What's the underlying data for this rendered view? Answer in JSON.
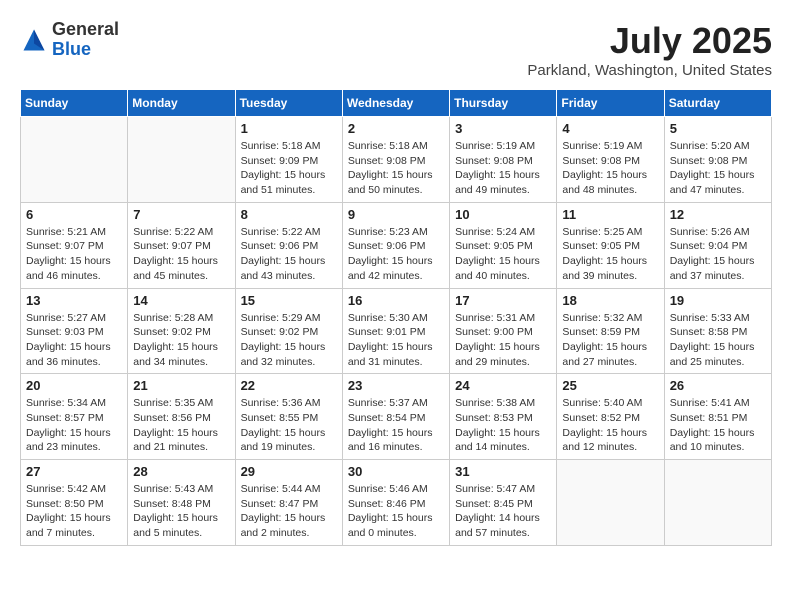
{
  "header": {
    "logo_general": "General",
    "logo_blue": "Blue",
    "month_title": "July 2025",
    "location": "Parkland, Washington, United States"
  },
  "weekdays": [
    "Sunday",
    "Monday",
    "Tuesday",
    "Wednesday",
    "Thursday",
    "Friday",
    "Saturday"
  ],
  "weeks": [
    [
      {
        "day": "",
        "info": ""
      },
      {
        "day": "",
        "info": ""
      },
      {
        "day": "1",
        "info": "Sunrise: 5:18 AM\nSunset: 9:09 PM\nDaylight: 15 hours\nand 51 minutes."
      },
      {
        "day": "2",
        "info": "Sunrise: 5:18 AM\nSunset: 9:08 PM\nDaylight: 15 hours\nand 50 minutes."
      },
      {
        "day": "3",
        "info": "Sunrise: 5:19 AM\nSunset: 9:08 PM\nDaylight: 15 hours\nand 49 minutes."
      },
      {
        "day": "4",
        "info": "Sunrise: 5:19 AM\nSunset: 9:08 PM\nDaylight: 15 hours\nand 48 minutes."
      },
      {
        "day": "5",
        "info": "Sunrise: 5:20 AM\nSunset: 9:08 PM\nDaylight: 15 hours\nand 47 minutes."
      }
    ],
    [
      {
        "day": "6",
        "info": "Sunrise: 5:21 AM\nSunset: 9:07 PM\nDaylight: 15 hours\nand 46 minutes."
      },
      {
        "day": "7",
        "info": "Sunrise: 5:22 AM\nSunset: 9:07 PM\nDaylight: 15 hours\nand 45 minutes."
      },
      {
        "day": "8",
        "info": "Sunrise: 5:22 AM\nSunset: 9:06 PM\nDaylight: 15 hours\nand 43 minutes."
      },
      {
        "day": "9",
        "info": "Sunrise: 5:23 AM\nSunset: 9:06 PM\nDaylight: 15 hours\nand 42 minutes."
      },
      {
        "day": "10",
        "info": "Sunrise: 5:24 AM\nSunset: 9:05 PM\nDaylight: 15 hours\nand 40 minutes."
      },
      {
        "day": "11",
        "info": "Sunrise: 5:25 AM\nSunset: 9:05 PM\nDaylight: 15 hours\nand 39 minutes."
      },
      {
        "day": "12",
        "info": "Sunrise: 5:26 AM\nSunset: 9:04 PM\nDaylight: 15 hours\nand 37 minutes."
      }
    ],
    [
      {
        "day": "13",
        "info": "Sunrise: 5:27 AM\nSunset: 9:03 PM\nDaylight: 15 hours\nand 36 minutes."
      },
      {
        "day": "14",
        "info": "Sunrise: 5:28 AM\nSunset: 9:02 PM\nDaylight: 15 hours\nand 34 minutes."
      },
      {
        "day": "15",
        "info": "Sunrise: 5:29 AM\nSunset: 9:02 PM\nDaylight: 15 hours\nand 32 minutes."
      },
      {
        "day": "16",
        "info": "Sunrise: 5:30 AM\nSunset: 9:01 PM\nDaylight: 15 hours\nand 31 minutes."
      },
      {
        "day": "17",
        "info": "Sunrise: 5:31 AM\nSunset: 9:00 PM\nDaylight: 15 hours\nand 29 minutes."
      },
      {
        "day": "18",
        "info": "Sunrise: 5:32 AM\nSunset: 8:59 PM\nDaylight: 15 hours\nand 27 minutes."
      },
      {
        "day": "19",
        "info": "Sunrise: 5:33 AM\nSunset: 8:58 PM\nDaylight: 15 hours\nand 25 minutes."
      }
    ],
    [
      {
        "day": "20",
        "info": "Sunrise: 5:34 AM\nSunset: 8:57 PM\nDaylight: 15 hours\nand 23 minutes."
      },
      {
        "day": "21",
        "info": "Sunrise: 5:35 AM\nSunset: 8:56 PM\nDaylight: 15 hours\nand 21 minutes."
      },
      {
        "day": "22",
        "info": "Sunrise: 5:36 AM\nSunset: 8:55 PM\nDaylight: 15 hours\nand 19 minutes."
      },
      {
        "day": "23",
        "info": "Sunrise: 5:37 AM\nSunset: 8:54 PM\nDaylight: 15 hours\nand 16 minutes."
      },
      {
        "day": "24",
        "info": "Sunrise: 5:38 AM\nSunset: 8:53 PM\nDaylight: 15 hours\nand 14 minutes."
      },
      {
        "day": "25",
        "info": "Sunrise: 5:40 AM\nSunset: 8:52 PM\nDaylight: 15 hours\nand 12 minutes."
      },
      {
        "day": "26",
        "info": "Sunrise: 5:41 AM\nSunset: 8:51 PM\nDaylight: 15 hours\nand 10 minutes."
      }
    ],
    [
      {
        "day": "27",
        "info": "Sunrise: 5:42 AM\nSunset: 8:50 PM\nDaylight: 15 hours\nand 7 minutes."
      },
      {
        "day": "28",
        "info": "Sunrise: 5:43 AM\nSunset: 8:48 PM\nDaylight: 15 hours\nand 5 minutes."
      },
      {
        "day": "29",
        "info": "Sunrise: 5:44 AM\nSunset: 8:47 PM\nDaylight: 15 hours\nand 2 minutes."
      },
      {
        "day": "30",
        "info": "Sunrise: 5:46 AM\nSunset: 8:46 PM\nDaylight: 15 hours\nand 0 minutes."
      },
      {
        "day": "31",
        "info": "Sunrise: 5:47 AM\nSunset: 8:45 PM\nDaylight: 14 hours\nand 57 minutes."
      },
      {
        "day": "",
        "info": ""
      },
      {
        "day": "",
        "info": ""
      }
    ]
  ]
}
